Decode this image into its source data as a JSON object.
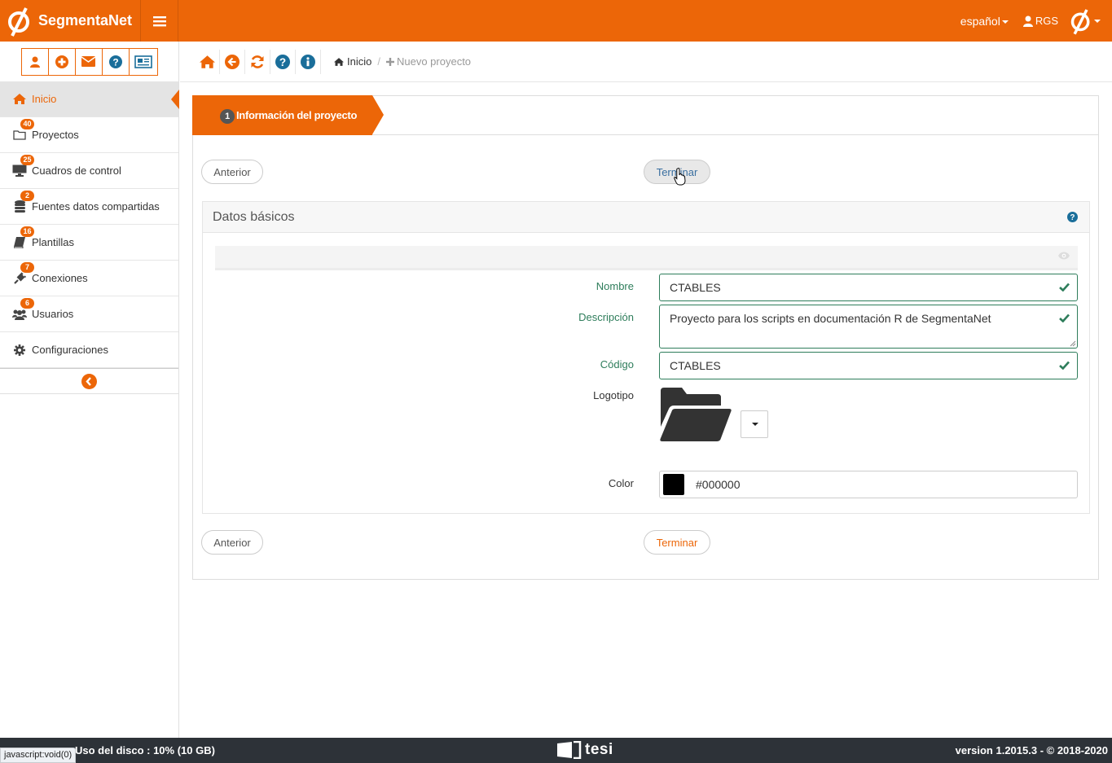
{
  "app": {
    "name": "SegmentaNet"
  },
  "topbar": {
    "language": "español",
    "user": "RGS"
  },
  "sidebar": {
    "quick_actions": [
      "user-icon",
      "plus-circle-icon",
      "envelope-icon",
      "question-icon",
      "newspaper-icon"
    ],
    "items": [
      {
        "label": "Inicio",
        "badge": ""
      },
      {
        "label": "Proyectos",
        "badge": "40"
      },
      {
        "label": "Cuadros de control",
        "badge": "25"
      },
      {
        "label": "Fuentes datos compartidas",
        "badge": "2"
      },
      {
        "label": "Plantillas",
        "badge": "16"
      },
      {
        "label": "Conexiones",
        "badge": "7"
      },
      {
        "label": "Usuarios",
        "badge": "6"
      },
      {
        "label": "Configuraciones",
        "badge": ""
      }
    ]
  },
  "breadcrumb": {
    "home": "Inicio",
    "current": "Nuevo proyecto"
  },
  "wizard": {
    "step_number": "1",
    "step_label": "Información del proyecto",
    "prev_label": "Anterior",
    "finish_label": "Terminar"
  },
  "form": {
    "section_title": "Datos básicos",
    "name_label": "Nombre",
    "name_value": "CTABLES",
    "description_label": "Descripción",
    "description_value": "Proyecto para los scripts en documentación R de SegmentaNet",
    "code_label": "Código",
    "code_value": "CTABLES",
    "logo_label": "Logotipo",
    "color_label": "Color",
    "color_value": "#000000"
  },
  "footer": {
    "disk": "Uso del disco : 10% (10 GB)",
    "brand": "tesi",
    "version": "version 1.2015.3 - © 2018-2020",
    "status_url": "javascript:void(0)"
  },
  "colors": {
    "accent": "#ec6608",
    "valid": "#2e7d5b",
    "footer": "#2d3238"
  }
}
